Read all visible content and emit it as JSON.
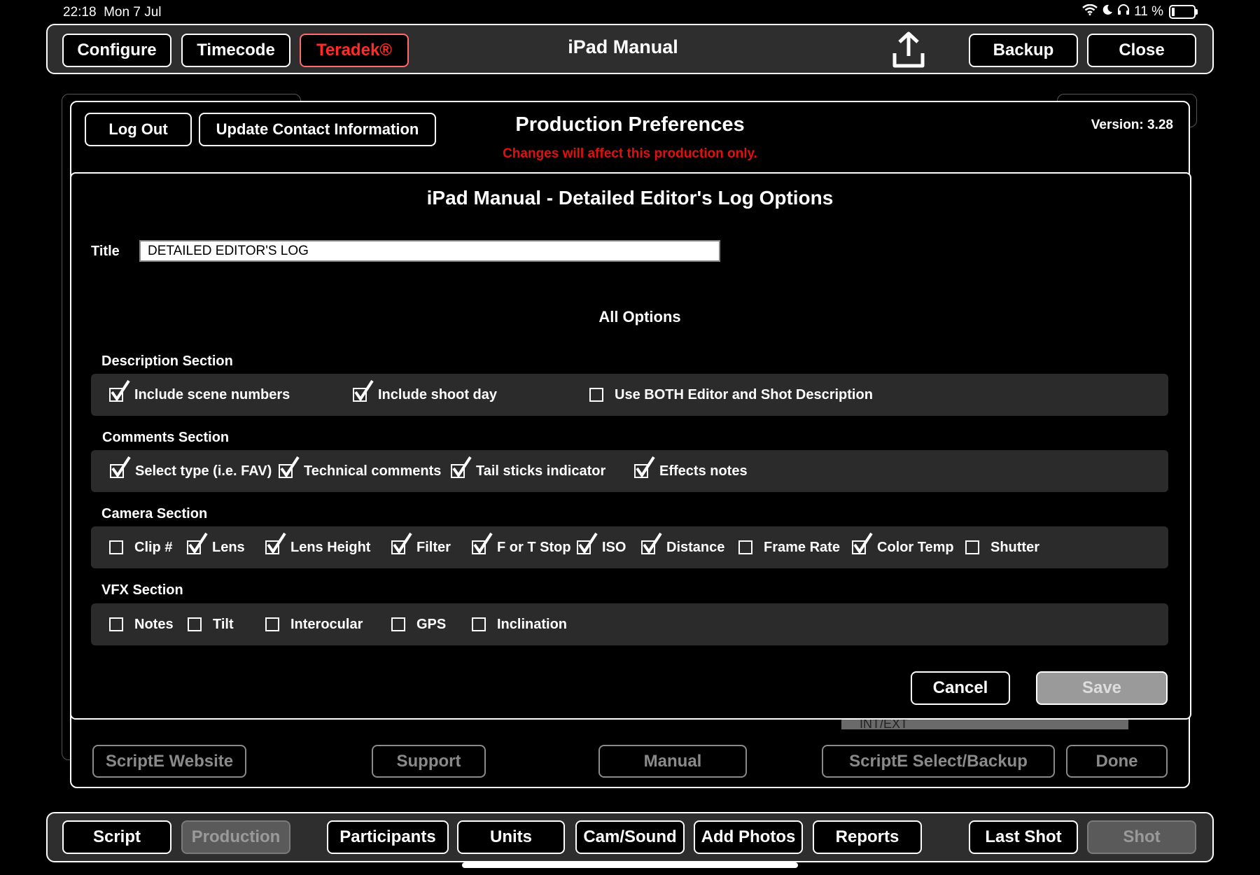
{
  "status": {
    "time": "22:18",
    "date": "Mon 7 Jul",
    "battery": "11 %"
  },
  "top_bar": {
    "configure": "Configure",
    "timecode": "Timecode",
    "teradek": "Teradek®",
    "title": "iPad Manual",
    "backup": "Backup",
    "close": "Close"
  },
  "prefs": {
    "logout": "Log Out",
    "update_contact": "Update Contact Information",
    "title": "Production Preferences",
    "warning": "Changes will affect this production only.",
    "version": "Version: 3.28",
    "bottom_buttons": [
      "ScriptE Website",
      "Support",
      "Manual",
      "ScriptE Select/Backup",
      "Done"
    ],
    "intext_hint": "INT/EXT"
  },
  "modal": {
    "title": "iPad Manual - Detailed Editor's Log Options",
    "title_label": "Title",
    "title_value": "DETAILED EDITOR'S LOG",
    "all_options": "All Options",
    "cancel": "Cancel",
    "save": "Save",
    "sections": [
      {
        "label": "Description Section",
        "options": [
          {
            "label": "Include scene numbers",
            "checked": true
          },
          {
            "label": "Include shoot day",
            "checked": true
          },
          {
            "label": "Use BOTH Editor and Shot Description",
            "checked": false
          }
        ]
      },
      {
        "label": "Comments Section",
        "options": [
          {
            "label": "Select type (i.e. FAV)",
            "checked": true
          },
          {
            "label": "Technical comments",
            "checked": true
          },
          {
            "label": "Tail sticks indicator",
            "checked": true
          },
          {
            "label": "Effects notes",
            "checked": true
          }
        ]
      },
      {
        "label": "Camera Section",
        "options": [
          {
            "label": "Clip #",
            "checked": false
          },
          {
            "label": "Lens",
            "checked": true
          },
          {
            "label": "Lens Height",
            "checked": true
          },
          {
            "label": "Filter",
            "checked": true
          },
          {
            "label": "F or T Stop",
            "checked": true
          },
          {
            "label": "ISO",
            "checked": true
          },
          {
            "label": "Distance",
            "checked": true
          },
          {
            "label": "Frame Rate",
            "checked": false
          },
          {
            "label": "Color Temp",
            "checked": true
          },
          {
            "label": "Shutter",
            "checked": false
          }
        ]
      },
      {
        "label": "VFX Section",
        "options": [
          {
            "label": "Notes",
            "checked": false
          },
          {
            "label": "Tilt",
            "checked": false
          },
          {
            "label": "Interocular",
            "checked": false
          },
          {
            "label": "GPS",
            "checked": false
          },
          {
            "label": "Inclination",
            "checked": false
          }
        ]
      }
    ]
  },
  "bottom_tabs": {
    "script": "Script",
    "production": "Production",
    "participants": "Participants",
    "units": "Units",
    "cam_sound": "Cam/Sound",
    "add_photos": "Add Photos",
    "reports": "Reports",
    "last_shot": "Last Shot",
    "shot": "Shot"
  },
  "colors": {
    "warning": "#e01010",
    "teradek": "#ff2a2a",
    "row_bg": "#2b2b2b"
  }
}
